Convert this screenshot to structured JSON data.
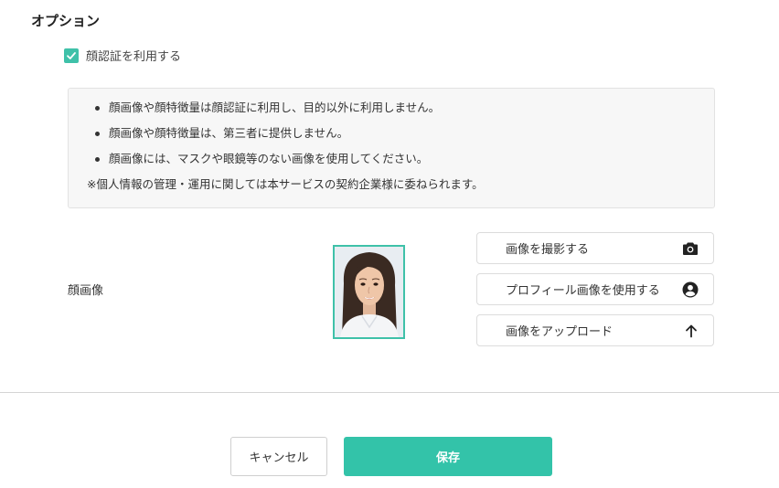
{
  "section": {
    "title": "オプション"
  },
  "face_auth": {
    "label": "顔認証を利用する",
    "checked": true
  },
  "notice": {
    "items": [
      "顔画像や顔特徴量は顔認証に利用し、目的以外に利用しません。",
      "顔画像や顔特徴量は、第三者に提供しません。",
      "顔画像には、マスクや眼鏡等のない画像を使用してください。"
    ],
    "footnote": "※個人情報の管理・運用に関しては本サービスの契約企業様に委ねられます。"
  },
  "face_image": {
    "label": "顔画像",
    "actions": [
      {
        "label": "画像を撮影する",
        "icon": "camera-icon"
      },
      {
        "label": "プロフィール画像を使用する",
        "icon": "account-circle-icon"
      },
      {
        "label": "画像をアップロード",
        "icon": "arrow-up-icon"
      }
    ]
  },
  "footer": {
    "cancel_label": "キャンセル",
    "save_label": "保存"
  },
  "colors": {
    "accent": "#33c3a9",
    "photo_border": "#3fc1a9"
  }
}
